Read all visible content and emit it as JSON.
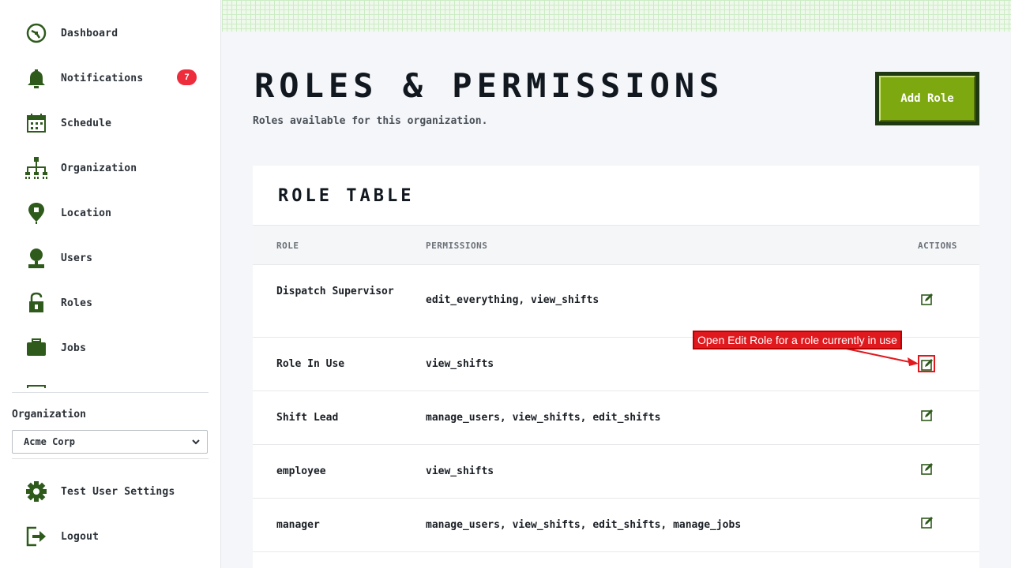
{
  "sidebar": {
    "items": [
      {
        "label": "Dashboard",
        "icon": "dashboard-icon"
      },
      {
        "label": "Notifications",
        "icon": "bell-icon",
        "badge": "7"
      },
      {
        "label": "Schedule",
        "icon": "calendar-icon"
      },
      {
        "label": "Organization",
        "icon": "org-chart-icon"
      },
      {
        "label": "Location",
        "icon": "location-pin-icon"
      },
      {
        "label": "Users",
        "icon": "user-icon"
      },
      {
        "label": "Roles",
        "icon": "lock-icon"
      },
      {
        "label": "Jobs",
        "icon": "briefcase-icon"
      }
    ],
    "organization_label": "Organization",
    "organization_value": "Acme Corp",
    "settings_label": "Test User Settings",
    "logout_label": "Logout"
  },
  "header": {
    "title": "Roles & Permissions",
    "subtitle": "Roles available for this organization.",
    "add_button": "Add Role"
  },
  "table": {
    "title": "Role Table",
    "columns": {
      "role": "ROLE",
      "permissions": "PERMISSIONS",
      "actions": "ACTIONS"
    },
    "rows": [
      {
        "role": "Dispatch Supervisor",
        "permissions": "edit_everything, view_shifts"
      },
      {
        "role": "Role In Use",
        "permissions": "view_shifts"
      },
      {
        "role": "Shift Lead",
        "permissions": "manage_users, view_shifts, edit_shifts"
      },
      {
        "role": "employee",
        "permissions": "view_shifts"
      },
      {
        "role": "manager",
        "permissions": "manage_users, view_shifts, edit_shifts, manage_jobs"
      }
    ]
  },
  "annotation": {
    "text": "Open Edit Role for a role currently in use"
  },
  "colors": {
    "accent_green": "#7da80f",
    "icon_green": "#2e5a1c",
    "badge_red": "#ee2d3c",
    "annotation_red": "#e0191e"
  }
}
